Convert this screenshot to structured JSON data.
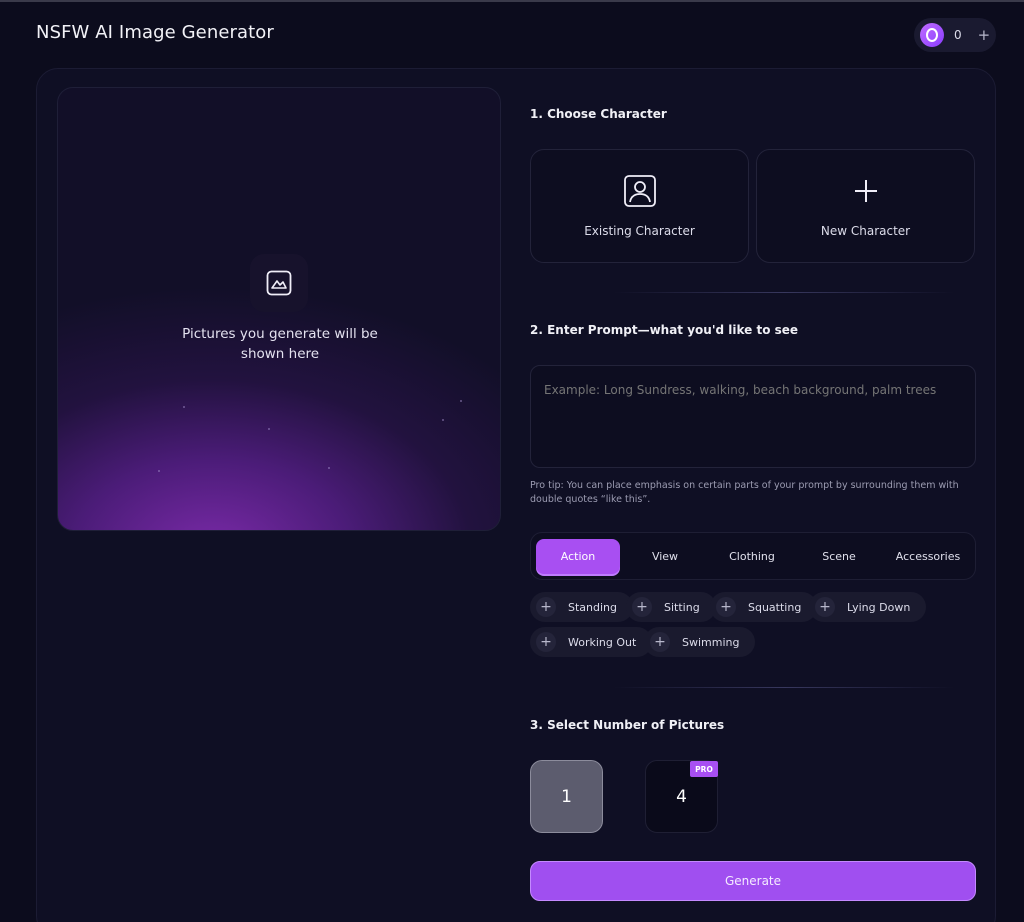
{
  "header": {
    "title": "NSFW AI Image Generator",
    "credits": "0",
    "add_label": "+"
  },
  "preview": {
    "line1": "Pictures you generate will be",
    "line2": "shown here"
  },
  "step1": {
    "title": "1. Choose Character",
    "existing_label": "Existing Character",
    "new_label": "New Character"
  },
  "step2": {
    "title": "2. Enter Prompt—what you'd like to see",
    "placeholder": "Example: Long Sundress, walking, beach background, palm trees",
    "tip": "Pro tip: You can place emphasis on certain parts of your prompt by surrounding them with double quotes “like this”."
  },
  "tabs": [
    "Action",
    "View",
    "Clothing",
    "Scene",
    "Accessories"
  ],
  "active_tab": "Action",
  "chips": [
    "Standing",
    "Sitting",
    "Squatting",
    "Lying Down",
    "Working Out",
    "Swimming"
  ],
  "step3": {
    "title": "3. Select Number of Pictures",
    "options": [
      "1",
      "4"
    ],
    "selected": "1",
    "pro_badge": "PRO"
  },
  "generate_label": "Generate",
  "colors": {
    "accent": "#a84ff2",
    "background": "#0c0c1d",
    "panel": "#0f0f24"
  },
  "icons": {
    "credit": "credit-coin-icon",
    "preview": "image-icon",
    "existing": "user-portrait-icon",
    "new": "plus-icon",
    "chip": "plus-icon"
  }
}
